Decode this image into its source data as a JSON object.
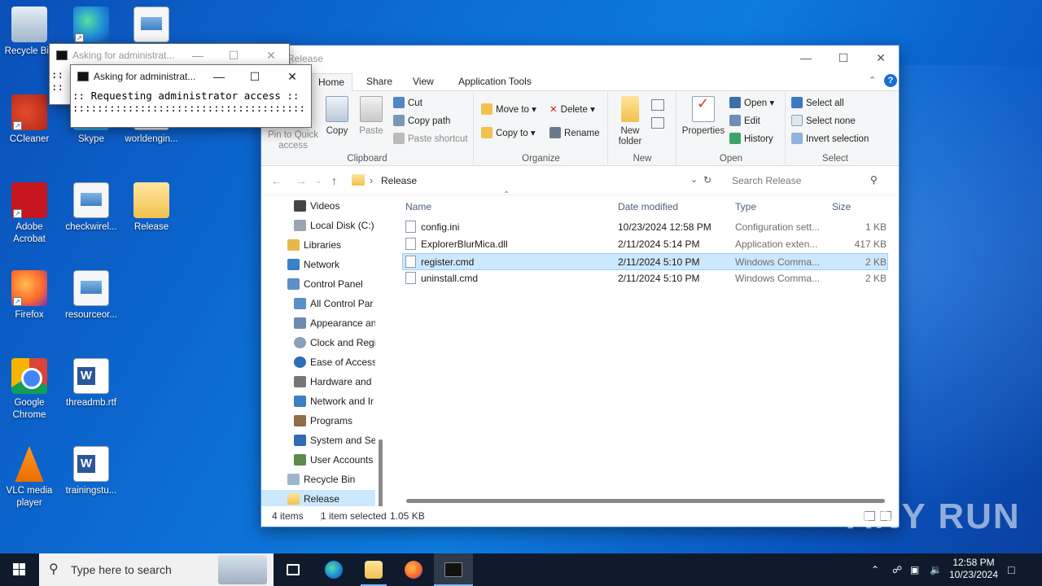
{
  "desktop": {
    "icons": [
      {
        "label": "Recycle Bin",
        "icon": "recycle-bin-icon"
      },
      {
        "label": "",
        "icon": "edge-icon"
      },
      {
        "label": "",
        "icon": "image-file-icon"
      },
      {
        "label": "CCleaner",
        "icon": "ccleaner-icon"
      },
      {
        "label": "Skype",
        "icon": "skype-icon"
      },
      {
        "label": "worldengin...",
        "icon": "image-file-icon"
      },
      {
        "label": "Adobe Acrobat",
        "icon": "adobe-acrobat-icon"
      },
      {
        "label": "checkwirel...",
        "icon": "image-file-icon"
      },
      {
        "label": "Release",
        "icon": "folder-icon"
      },
      {
        "label": "Firefox",
        "icon": "firefox-icon"
      },
      {
        "label": "resourceor...",
        "icon": "image-file-icon"
      },
      {
        "label": "Google Chrome",
        "icon": "chrome-icon"
      },
      {
        "label": "threadmb.rtf",
        "icon": "word-document-icon"
      },
      {
        "label": "VLC media player",
        "icon": "vlc-icon"
      },
      {
        "label": "trainingstu...",
        "icon": "word-document-icon"
      }
    ]
  },
  "console_back": {
    "title": "Asking for administrat...",
    "lines": [
      "::",
      "::"
    ]
  },
  "console_front": {
    "title": "Asking for administrat...",
    "line1": ":: Requesting administrator access ::",
    "line2": "::::::::::::::::::::::::::::::::::::::"
  },
  "explorer": {
    "title": "Release",
    "tabs": {
      "file": "",
      "home": "Home",
      "share": "Share",
      "view": "View",
      "app_tools": "Application Tools"
    },
    "ribbon": {
      "clipboard": {
        "pin": "Pin to Quick access",
        "copy": "Copy",
        "paste": "Paste",
        "cut": "Cut",
        "copy_path": "Copy path",
        "paste_shortcut": "Paste shortcut",
        "label": "Clipboard"
      },
      "organize": {
        "move_to": "Move to",
        "copy_to": "Copy to",
        "delete": "Delete",
        "rename": "Rename",
        "label": "Organize"
      },
      "new": {
        "new_folder": "New folder",
        "label": "New"
      },
      "open": {
        "properties": "Properties",
        "open": "Open",
        "edit": "Edit",
        "history": "History",
        "label": "Open"
      },
      "select": {
        "select_all": "Select all",
        "select_none": "Select none",
        "invert": "Invert selection",
        "label": "Select"
      }
    },
    "address": {
      "path": "Release",
      "search_placeholder": "Search Release"
    },
    "nav": [
      {
        "label": "Videos",
        "icon": "videos-icon"
      },
      {
        "label": "Local Disk (C:)",
        "icon": "drive-icon"
      },
      {
        "label": "Libraries",
        "icon": "libraries-icon"
      },
      {
        "label": "Network",
        "icon": "network-icon"
      },
      {
        "label": "Control Panel",
        "icon": "control-panel-icon"
      },
      {
        "label": "All Control Par",
        "icon": "control-panel-icon"
      },
      {
        "label": "Appearance an",
        "icon": "appearance-icon"
      },
      {
        "label": "Clock and Regi",
        "icon": "clock-icon"
      },
      {
        "label": "Ease of Access",
        "icon": "ease-of-access-icon"
      },
      {
        "label": "Hardware and",
        "icon": "hardware-icon"
      },
      {
        "label": "Network and Ir",
        "icon": "network-icon"
      },
      {
        "label": "Programs",
        "icon": "programs-icon"
      },
      {
        "label": "System and Sec",
        "icon": "system-security-icon"
      },
      {
        "label": "User Accounts",
        "icon": "user-accounts-icon"
      },
      {
        "label": "Recycle Bin",
        "icon": "recycle-bin-icon"
      },
      {
        "label": "Release",
        "icon": "folder-icon"
      }
    ],
    "columns": {
      "name": "Name",
      "date": "Date modified",
      "type": "Type",
      "size": "Size"
    },
    "files": [
      {
        "name": "config.ini",
        "date": "10/23/2024 12:58 PM",
        "type": "Configuration sett...",
        "size": "1 KB"
      },
      {
        "name": "ExplorerBlurMica.dll",
        "date": "2/11/2024 5:14 PM",
        "type": "Application exten...",
        "size": "417 KB"
      },
      {
        "name": "register.cmd",
        "date": "2/11/2024 5:10 PM",
        "type": "Windows Comma...",
        "size": "2 KB"
      },
      {
        "name": "uninstall.cmd",
        "date": "2/11/2024 5:10 PM",
        "type": "Windows Comma...",
        "size": "2 KB"
      }
    ],
    "selected_index": 2,
    "status": {
      "items": "4 items",
      "selected": "1 item selected",
      "size": "1.05 KB"
    }
  },
  "taskbar": {
    "search_placeholder": "Type here to search",
    "time": "12:58 PM",
    "date": "10/23/2024"
  },
  "watermark": "ANY RUN",
  "colors": {
    "accent": "#0078d7",
    "selection": "#cce8ff",
    "taskbar": "#0f1b2d"
  }
}
